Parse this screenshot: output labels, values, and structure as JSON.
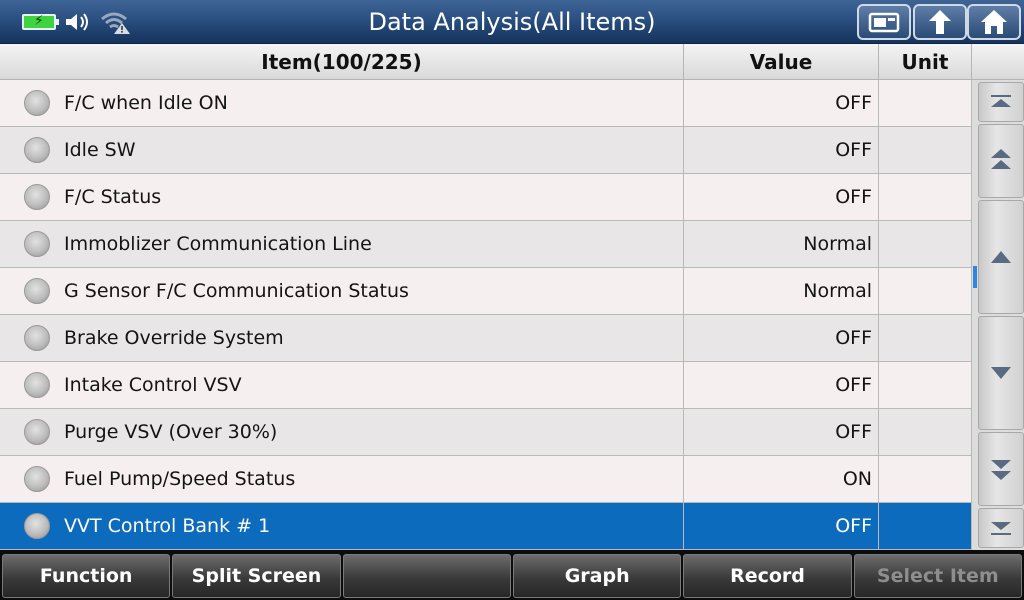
{
  "header": {
    "title": "Data Analysis(All Items)",
    "status_icons": [
      "battery-charging-icon",
      "speaker-icon",
      "wifi-warning-icon"
    ],
    "buttons": [
      "screenshot-icon",
      "back-icon",
      "home-icon"
    ]
  },
  "table": {
    "columns": {
      "item": "Item(100/225)",
      "value": "Value",
      "unit": "Unit"
    },
    "rows": [
      {
        "item": "F/C when Idle ON",
        "value": "OFF",
        "unit": ""
      },
      {
        "item": "Idle SW",
        "value": "OFF",
        "unit": ""
      },
      {
        "item": "F/C Status",
        "value": "OFF",
        "unit": ""
      },
      {
        "item": "Immoblizer Communication Line",
        "value": "Normal",
        "unit": ""
      },
      {
        "item": "G Sensor F/C Communication Status",
        "value": "Normal",
        "unit": ""
      },
      {
        "item": "Brake Override System",
        "value": "OFF",
        "unit": ""
      },
      {
        "item": "Intake Control VSV",
        "value": "OFF",
        "unit": ""
      },
      {
        "item": "Purge VSV (Over 30%)",
        "value": "OFF",
        "unit": ""
      },
      {
        "item": "Fuel Pump/Speed Status",
        "value": "ON",
        "unit": ""
      },
      {
        "item": "VVT Control Bank # 1",
        "value": "OFF",
        "unit": ""
      }
    ],
    "selected_row": 9
  },
  "scroll": {
    "buttons": [
      "scroll-top-icon",
      "page-up-icon",
      "line-up-icon",
      "line-down-icon",
      "page-down-icon",
      "scroll-bottom-icon"
    ]
  },
  "toolbar": {
    "function": "Function",
    "split_screen": "Split Screen",
    "blank": "",
    "graph": "Graph",
    "record": "Record",
    "select_item": "Select Item"
  },
  "colors": {
    "title_bar": "#2a4f80",
    "selected_row": "#0d6bbd",
    "battery": "#3fd43f"
  }
}
